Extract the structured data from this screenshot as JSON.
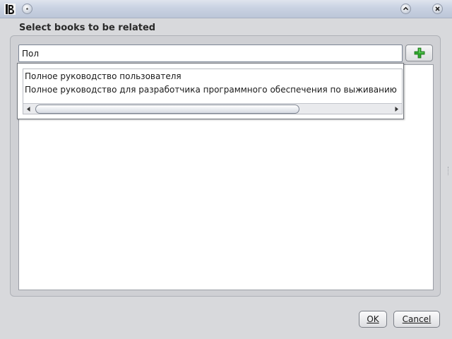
{
  "window": {
    "icons": {
      "app": "app-logo-icon",
      "menu": "window-menu-icon",
      "minimize": "minimize-icon",
      "close": "close-icon"
    }
  },
  "dialog": {
    "title": "Select books to be related",
    "search": {
      "value": "Пол",
      "placeholder": ""
    },
    "add_button": {
      "icon": "plus-icon",
      "color": "#2fa52c"
    },
    "suggestions": [
      "Полное руководство пользователя",
      "Полное руководство для разработчика программного обеспечения по выживанию"
    ],
    "buttons": {
      "ok": "OK",
      "cancel": "Cancel"
    }
  }
}
